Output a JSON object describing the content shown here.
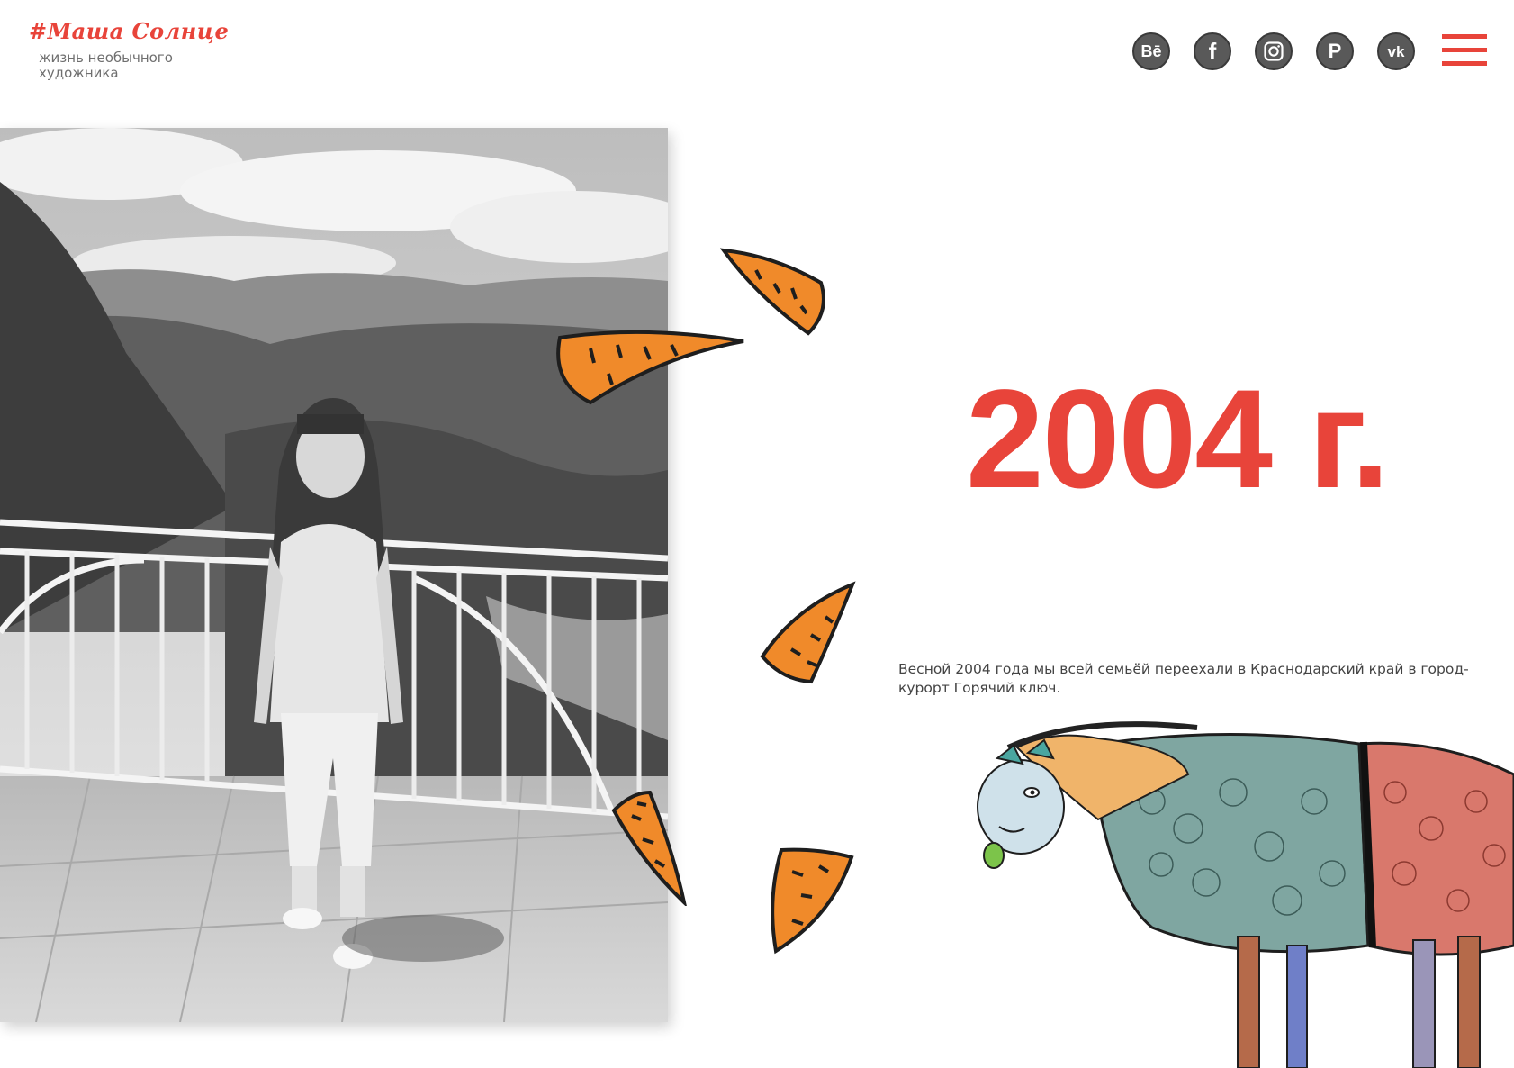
{
  "header": {
    "logo_title": "#Маша Солнце",
    "logo_subtitle": "жизнь необычного художника",
    "social_links": [
      {
        "label": "Bē",
        "icon": "behance-icon",
        "name": "behance-link"
      },
      {
        "label": "f",
        "icon": "facebook-icon",
        "name": "facebook-link"
      },
      {
        "label": "",
        "icon": "instagram-icon",
        "name": "instagram-link"
      },
      {
        "label": "P",
        "icon": "pinterest-icon",
        "name": "pinterest-link"
      },
      {
        "label": "vk",
        "icon": "vk-icon",
        "name": "vk-link"
      }
    ],
    "menu_icon": "hamburger-menu-icon"
  },
  "main": {
    "year": "2004 г.",
    "description": "Весной 2004 года мы всей семьёй переехали в  Краснодарский край в город-курорт Горячий ключ."
  },
  "colors": {
    "accent": "#e8443a",
    "social_bg": "#595959",
    "text": "#444444",
    "carrot": "#f08a2a"
  }
}
